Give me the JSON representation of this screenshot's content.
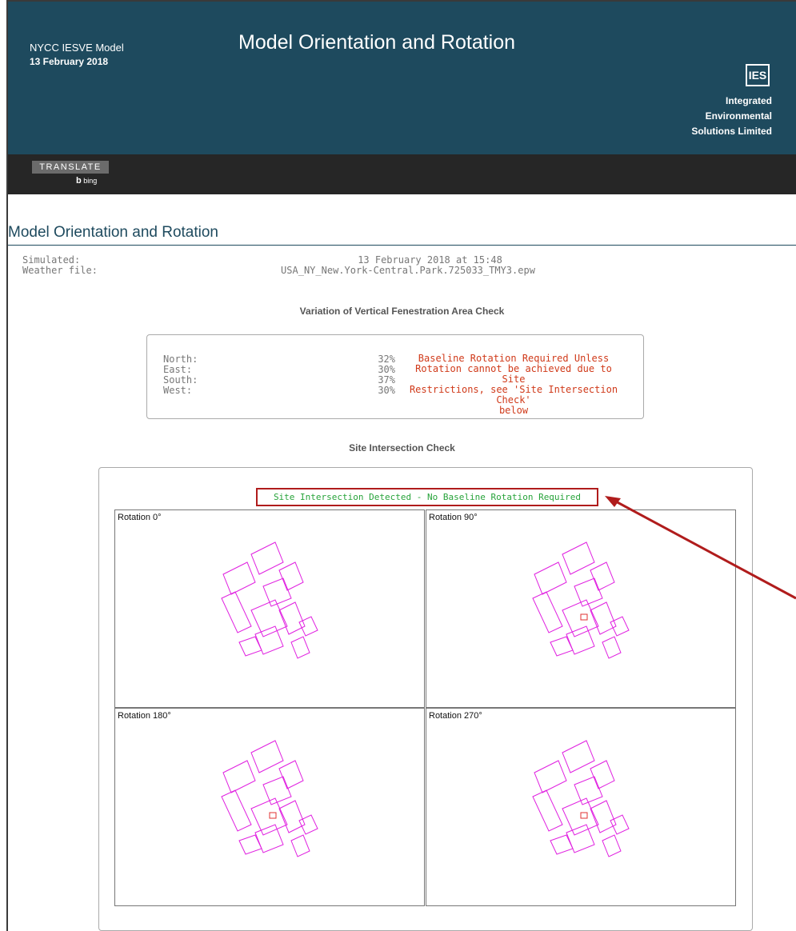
{
  "header": {
    "model_name": "NYCC IESVE Model",
    "model_date": "13 February 2018",
    "title": "Model Orientation and Rotation",
    "logo_text": "IES",
    "company_lines": [
      "Integrated",
      "Environmental",
      "Solutions Limited"
    ],
    "background_color": "#1e4a5e"
  },
  "toolbar": {
    "translate_label": "TRANSLATE",
    "bing_label": "bing",
    "bing_icon": "b"
  },
  "section": {
    "title": "Model Orientation and Rotation"
  },
  "meta": {
    "simulated_label": "Simulated:",
    "simulated_value": "13 February 2018 at 15:48",
    "weather_label": "Weather file:",
    "weather_value": "USA_NY_New.York-Central.Park.725033_TMY3.epw"
  },
  "fenestration": {
    "heading": "Variation of Vertical Fenestration Area Check",
    "rows": [
      {
        "label": "North:",
        "value": "32%"
      },
      {
        "label": "East:",
        "value": "30%"
      },
      {
        "label": "South:",
        "value": "37%"
      },
      {
        "label": "West:",
        "value": "30%"
      }
    ],
    "message_lines": [
      "Baseline Rotation Required Unless",
      "Rotation cannot be achieved due to Site",
      "Restrictions, see 'Site Intersection Check'",
      "below"
    ],
    "message_color": "#d03a1a"
  },
  "site_check": {
    "heading": "Site Intersection Check",
    "status": "Site Intersection Detected - No Baseline Rotation Required",
    "status_color": "#27a33a",
    "highlight_color": "#b01c1c",
    "panels": [
      {
        "label": "Rotation 0°"
      },
      {
        "label": "Rotation 90°"
      },
      {
        "label": "Rotation 180°"
      },
      {
        "label": "Rotation 270°"
      }
    ],
    "drawing_color": "#e020e0",
    "intersection_color": "#e03030"
  }
}
